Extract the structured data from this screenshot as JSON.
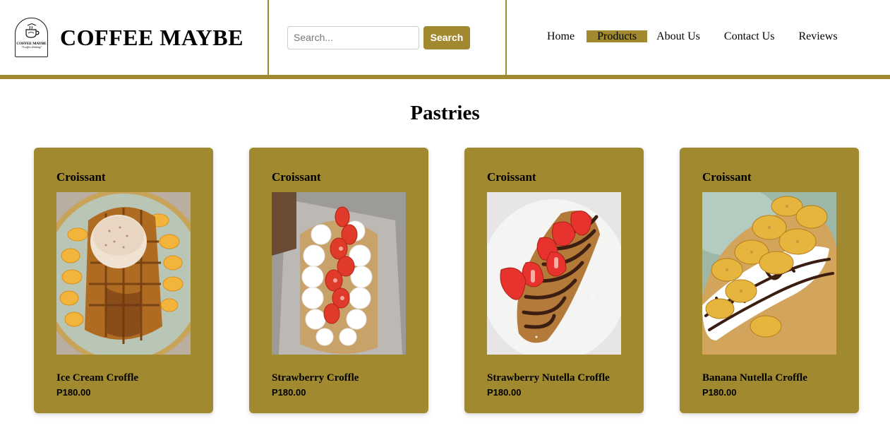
{
  "brand": {
    "title": "COFFEE MAYBE",
    "logo_name": "COFFEE MAYBE",
    "logo_tagline": "\"A coffee drinking\"",
    "logo_icon": "coffee-cup-icon"
  },
  "search": {
    "placeholder": "Search...",
    "button_label": "Search"
  },
  "nav": {
    "items": [
      {
        "label": "Home"
      },
      {
        "label": "Products",
        "active": true
      },
      {
        "label": "About Us"
      },
      {
        "label": "Contact Us"
      },
      {
        "label": "Reviews"
      }
    ]
  },
  "section": {
    "title": "Pastries"
  },
  "products": [
    {
      "category": "Croissant",
      "name": "Ice Cream Croffle",
      "price": "P180.00",
      "image": "ice-cream-croffle-photo"
    },
    {
      "category": "Croissant",
      "name": "Strawberry Croffle",
      "price": "P180.00",
      "image": "strawberry-croffle-photo"
    },
    {
      "category": "Croissant",
      "name": "Strawberry Nutella Croffle",
      "price": "P180.00",
      "image": "strawberry-nutella-croffle-photo"
    },
    {
      "category": "Croissant",
      "name": "Banana Nutella Croffle",
      "price": "P180.00",
      "image": "banana-nutella-croffle-photo"
    }
  ],
  "colors": {
    "accent": "#a0892f",
    "background": "#ffffff",
    "text": "#000000"
  }
}
